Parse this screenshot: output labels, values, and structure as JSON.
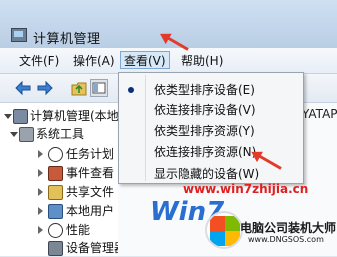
{
  "window": {
    "title": "计算机管理"
  },
  "menubar": [
    {
      "label": "文件(F)",
      "active": false
    },
    {
      "label": "操作(A)",
      "active": false
    },
    {
      "label": "查看(V)",
      "active": true
    },
    {
      "label": "帮助(H)",
      "active": false
    }
  ],
  "view_menu": {
    "items": [
      {
        "label": "依类型排序设备(E)",
        "checked": true
      },
      {
        "label": "依连接排序设备(V)",
        "checked": false
      },
      {
        "label": "依类型排序资源(Y)",
        "checked": false
      },
      {
        "label": "依连接排序资源(N)",
        "checked": false
      },
      {
        "label": "显示隐藏的设备(W)",
        "checked": false
      }
    ]
  },
  "tree": {
    "items": [
      {
        "label": "计算机管理(本地",
        "indent": 0,
        "expander": "open",
        "icon": "computer-icon"
      },
      {
        "label": "系统工具",
        "indent": 1,
        "expander": "open",
        "icon": "tools-icon"
      },
      {
        "label": "任务计划",
        "indent": 2,
        "expander": "closed",
        "icon": "clock-icon"
      },
      {
        "label": "事件查看",
        "indent": 2,
        "expander": "closed",
        "icon": "event-viewer-icon"
      },
      {
        "label": "共享文件",
        "indent": 2,
        "expander": "closed",
        "icon": "shared-folder-icon"
      },
      {
        "label": "本地用户",
        "indent": 2,
        "expander": "closed",
        "icon": "users-icon"
      },
      {
        "label": "性能",
        "indent": 2,
        "expander": "closed",
        "icon": "performance-icon"
      },
      {
        "label": "设备管理器",
        "indent": 2,
        "expander": "none",
        "icon": "device-manager-icon"
      }
    ]
  },
  "right_pane": {
    "text": "YATAP"
  },
  "watermark": {
    "url": "www.win7zhijia.cn",
    "brand": "Win7",
    "site_cn": "电脑公司装机大师",
    "site_en": "www.DNGSOS.com"
  },
  "colors": {
    "accent_red": "#e23b2a",
    "menu_highlight": "#d7e8f7",
    "watermark_blue": "#2a6fd0"
  }
}
